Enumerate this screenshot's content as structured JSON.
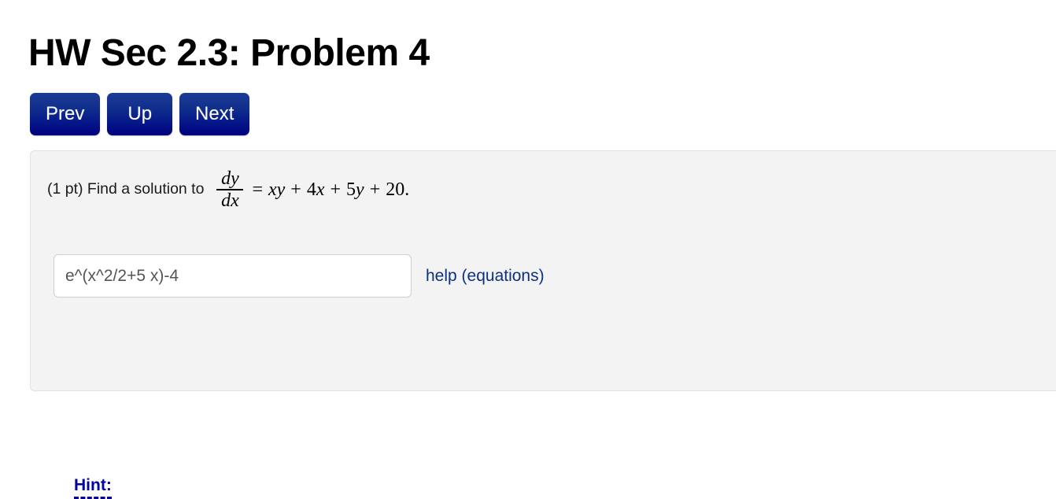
{
  "page": {
    "title": "HW Sec 2.3: Problem 4"
  },
  "nav": {
    "prev_label": "Prev",
    "up_label": "Up",
    "next_label": "Next"
  },
  "problem": {
    "points_label": "(1 pt) Find a solution to",
    "equation": {
      "fraction_numerator": "dy",
      "fraction_denominator": "dx",
      "equals": "=",
      "term1": "xy",
      "plus1": "+",
      "coef2": "4",
      "var2": "x",
      "plus2": "+",
      "coef3": "5",
      "var3": "y",
      "plus3": "+",
      "constant": "20",
      "period": ".",
      "plain_text": "dy/dx = xy + 4x + 5y + 20."
    },
    "answer_value": "e^(x^2/2+5 x)-4",
    "answer_placeholder": "",
    "help_link_label": "help (equations)",
    "hint_label": "Hint:"
  },
  "colors": {
    "button_top": "#1b3d96",
    "button_bottom": "#00017c",
    "link_navy": "#0d307f",
    "hint_blue": "#0000a0",
    "panel_bg": "#f3f3f3",
    "panel_border": "#e2e2e2",
    "input_border": "#cfcfcf",
    "input_text": "#555555"
  }
}
